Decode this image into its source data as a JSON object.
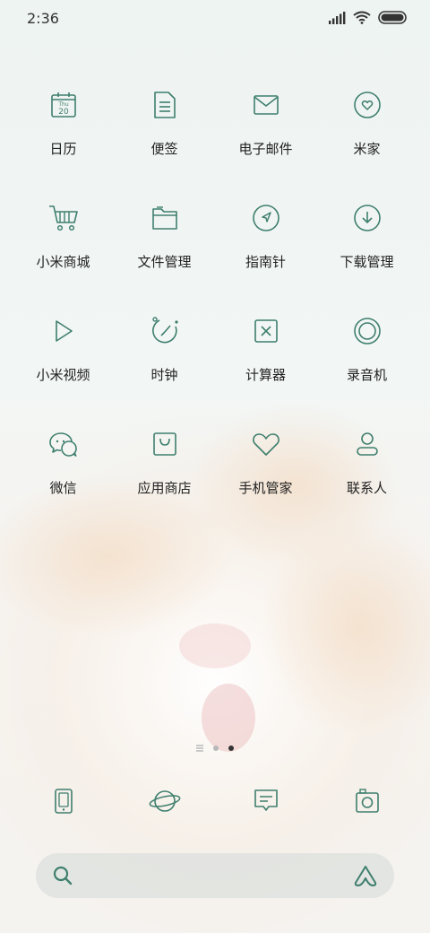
{
  "status_bar": {
    "time": "2:36"
  },
  "colors": {
    "icon_stroke": "#3f7f6e",
    "text": "#222222",
    "dot_active": "#333333",
    "dot_inactive": "#b8b8b8"
  },
  "apps": [
    {
      "label": "日历",
      "icon": "calendar-icon",
      "calendar_day": "Thu",
      "calendar_date": "20"
    },
    {
      "label": "便签",
      "icon": "notes-icon"
    },
    {
      "label": "电子邮件",
      "icon": "mail-icon"
    },
    {
      "label": "米家",
      "icon": "mijia-icon"
    },
    {
      "label": "小米商城",
      "icon": "cart-icon"
    },
    {
      "label": "文件管理",
      "icon": "folder-icon"
    },
    {
      "label": "指南针",
      "icon": "compass-icon"
    },
    {
      "label": "下载管理",
      "icon": "download-icon"
    },
    {
      "label": "小米视频",
      "icon": "play-icon"
    },
    {
      "label": "时钟",
      "icon": "clock-icon"
    },
    {
      "label": "计算器",
      "icon": "calculator-icon"
    },
    {
      "label": "录音机",
      "icon": "recorder-icon"
    },
    {
      "label": "微信",
      "icon": "wechat-icon"
    },
    {
      "label": "应用商店",
      "icon": "app-store-icon"
    },
    {
      "label": "手机管家",
      "icon": "security-icon"
    },
    {
      "label": "联系人",
      "icon": "contacts-icon"
    }
  ],
  "pages": {
    "count": 3,
    "current": 3
  },
  "dock": [
    {
      "icon": "phone-icon"
    },
    {
      "icon": "browser-planet-icon"
    },
    {
      "icon": "messages-icon"
    },
    {
      "icon": "camera-icon"
    }
  ]
}
